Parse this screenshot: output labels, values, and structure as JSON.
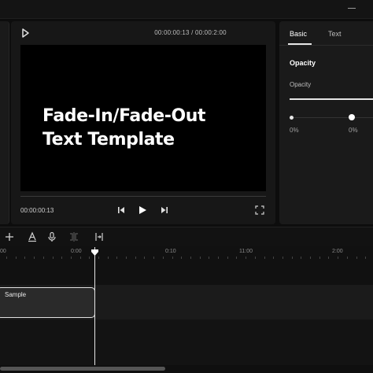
{
  "player": {
    "current_time": "00:00:00:13",
    "duration": "00:00:2:00",
    "time_display": "00:00:00:13 / 00:00:2:00",
    "bottom_time": "00:00:00:13",
    "preview_title_line1": "Fade-In/Fade-Out",
    "preview_title_line2": "Text Template"
  },
  "inspector": {
    "tabs": [
      {
        "label": "Basic",
        "active": true
      },
      {
        "label": "Text",
        "active": false
      }
    ],
    "section_title": "Opacity",
    "opacity_label": "Opacity",
    "opacity_value": 1.0,
    "keyframe_values": [
      "0%",
      "0%"
    ]
  },
  "timeline": {
    "ruler_labels": [
      "00",
      "0:00",
      "0:10",
      "11:00",
      "2:00"
    ],
    "clip_label": "Sample"
  },
  "icons": {
    "play_small": "play-outline-icon",
    "skip_back": "skip-back-icon",
    "play": "play-icon",
    "skip_forward": "skip-forward-icon",
    "fullscreen": "fullscreen-icon",
    "add": "add-icon",
    "text": "text-icon",
    "mic": "microphone-icon",
    "split": "split-icon",
    "trim": "trim-icon"
  },
  "colors": {
    "background": "#0d0d0d",
    "panel": "#1a1a1a",
    "accent": "#e6e6e6"
  }
}
